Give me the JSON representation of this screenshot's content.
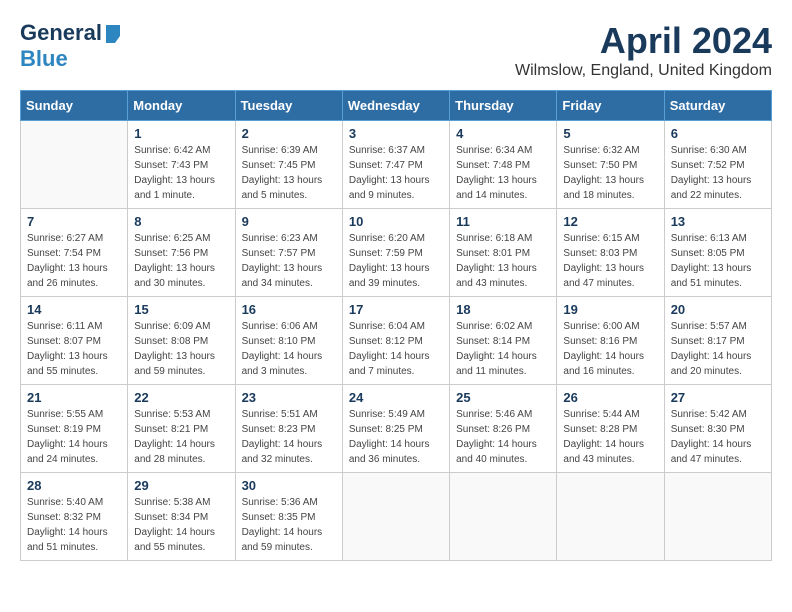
{
  "header": {
    "logo_line1": "General",
    "logo_line2": "Blue",
    "month_title": "April 2024",
    "location": "Wilmslow, England, United Kingdom"
  },
  "weekdays": [
    "Sunday",
    "Monday",
    "Tuesday",
    "Wednesday",
    "Thursday",
    "Friday",
    "Saturday"
  ],
  "weeks": [
    [
      {
        "day": "",
        "info": ""
      },
      {
        "day": "1",
        "info": "Sunrise: 6:42 AM\nSunset: 7:43 PM\nDaylight: 13 hours\nand 1 minute."
      },
      {
        "day": "2",
        "info": "Sunrise: 6:39 AM\nSunset: 7:45 PM\nDaylight: 13 hours\nand 5 minutes."
      },
      {
        "day": "3",
        "info": "Sunrise: 6:37 AM\nSunset: 7:47 PM\nDaylight: 13 hours\nand 9 minutes."
      },
      {
        "day": "4",
        "info": "Sunrise: 6:34 AM\nSunset: 7:48 PM\nDaylight: 13 hours\nand 14 minutes."
      },
      {
        "day": "5",
        "info": "Sunrise: 6:32 AM\nSunset: 7:50 PM\nDaylight: 13 hours\nand 18 minutes."
      },
      {
        "day": "6",
        "info": "Sunrise: 6:30 AM\nSunset: 7:52 PM\nDaylight: 13 hours\nand 22 minutes."
      }
    ],
    [
      {
        "day": "7",
        "info": "Sunrise: 6:27 AM\nSunset: 7:54 PM\nDaylight: 13 hours\nand 26 minutes."
      },
      {
        "day": "8",
        "info": "Sunrise: 6:25 AM\nSunset: 7:56 PM\nDaylight: 13 hours\nand 30 minutes."
      },
      {
        "day": "9",
        "info": "Sunrise: 6:23 AM\nSunset: 7:57 PM\nDaylight: 13 hours\nand 34 minutes."
      },
      {
        "day": "10",
        "info": "Sunrise: 6:20 AM\nSunset: 7:59 PM\nDaylight: 13 hours\nand 39 minutes."
      },
      {
        "day": "11",
        "info": "Sunrise: 6:18 AM\nSunset: 8:01 PM\nDaylight: 13 hours\nand 43 minutes."
      },
      {
        "day": "12",
        "info": "Sunrise: 6:15 AM\nSunset: 8:03 PM\nDaylight: 13 hours\nand 47 minutes."
      },
      {
        "day": "13",
        "info": "Sunrise: 6:13 AM\nSunset: 8:05 PM\nDaylight: 13 hours\nand 51 minutes."
      }
    ],
    [
      {
        "day": "14",
        "info": "Sunrise: 6:11 AM\nSunset: 8:07 PM\nDaylight: 13 hours\nand 55 minutes."
      },
      {
        "day": "15",
        "info": "Sunrise: 6:09 AM\nSunset: 8:08 PM\nDaylight: 13 hours\nand 59 minutes."
      },
      {
        "day": "16",
        "info": "Sunrise: 6:06 AM\nSunset: 8:10 PM\nDaylight: 14 hours\nand 3 minutes."
      },
      {
        "day": "17",
        "info": "Sunrise: 6:04 AM\nSunset: 8:12 PM\nDaylight: 14 hours\nand 7 minutes."
      },
      {
        "day": "18",
        "info": "Sunrise: 6:02 AM\nSunset: 8:14 PM\nDaylight: 14 hours\nand 11 minutes."
      },
      {
        "day": "19",
        "info": "Sunrise: 6:00 AM\nSunset: 8:16 PM\nDaylight: 14 hours\nand 16 minutes."
      },
      {
        "day": "20",
        "info": "Sunrise: 5:57 AM\nSunset: 8:17 PM\nDaylight: 14 hours\nand 20 minutes."
      }
    ],
    [
      {
        "day": "21",
        "info": "Sunrise: 5:55 AM\nSunset: 8:19 PM\nDaylight: 14 hours\nand 24 minutes."
      },
      {
        "day": "22",
        "info": "Sunrise: 5:53 AM\nSunset: 8:21 PM\nDaylight: 14 hours\nand 28 minutes."
      },
      {
        "day": "23",
        "info": "Sunrise: 5:51 AM\nSunset: 8:23 PM\nDaylight: 14 hours\nand 32 minutes."
      },
      {
        "day": "24",
        "info": "Sunrise: 5:49 AM\nSunset: 8:25 PM\nDaylight: 14 hours\nand 36 minutes."
      },
      {
        "day": "25",
        "info": "Sunrise: 5:46 AM\nSunset: 8:26 PM\nDaylight: 14 hours\nand 40 minutes."
      },
      {
        "day": "26",
        "info": "Sunrise: 5:44 AM\nSunset: 8:28 PM\nDaylight: 14 hours\nand 43 minutes."
      },
      {
        "day": "27",
        "info": "Sunrise: 5:42 AM\nSunset: 8:30 PM\nDaylight: 14 hours\nand 47 minutes."
      }
    ],
    [
      {
        "day": "28",
        "info": "Sunrise: 5:40 AM\nSunset: 8:32 PM\nDaylight: 14 hours\nand 51 minutes."
      },
      {
        "day": "29",
        "info": "Sunrise: 5:38 AM\nSunset: 8:34 PM\nDaylight: 14 hours\nand 55 minutes."
      },
      {
        "day": "30",
        "info": "Sunrise: 5:36 AM\nSunset: 8:35 PM\nDaylight: 14 hours\nand 59 minutes."
      },
      {
        "day": "",
        "info": ""
      },
      {
        "day": "",
        "info": ""
      },
      {
        "day": "",
        "info": ""
      },
      {
        "day": "",
        "info": ""
      }
    ]
  ]
}
